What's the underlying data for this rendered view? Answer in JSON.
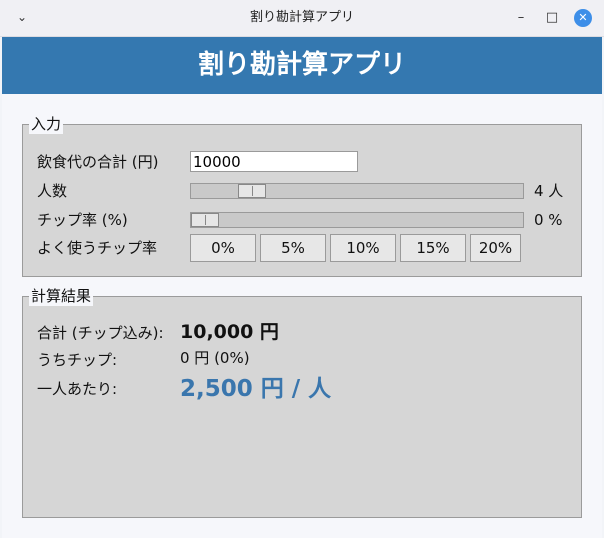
{
  "window": {
    "title": "割り勘計算アプリ"
  },
  "header": {
    "title": "割り勘計算アプリ"
  },
  "input_group": {
    "title": "入力",
    "amount_label": "飲食代の合計 (円)",
    "amount_value": "10000",
    "people_label": "人数",
    "people_value_text": "4 人",
    "people_value": 4,
    "tip_label": "チップ率 (%)",
    "tip_value_text": "0 %",
    "tip_value": 0,
    "quick_tip_label": "よく使うチップ率",
    "quick_tips": [
      "0%",
      "5%",
      "10%",
      "15%",
      "20%"
    ]
  },
  "result_group": {
    "title": "計算結果",
    "total_label": "合計 (チップ込み):",
    "total_value": "10,000 円",
    "tip_label": "うちチップ:",
    "tip_value": "0 円 (0%)",
    "per_person_label": "一人あたり:",
    "per_person_value": "2,500 円 / 人"
  },
  "colors": {
    "header_bg": "#3478b0",
    "accent_text": "#3a76ad",
    "panel_bg": "#d6d6d6",
    "close_button": "#3d8ee8"
  },
  "icons": {
    "menu": "chevron-down-icon",
    "minimize": "minimize-icon",
    "maximize": "maximize-icon",
    "close": "close-icon"
  }
}
